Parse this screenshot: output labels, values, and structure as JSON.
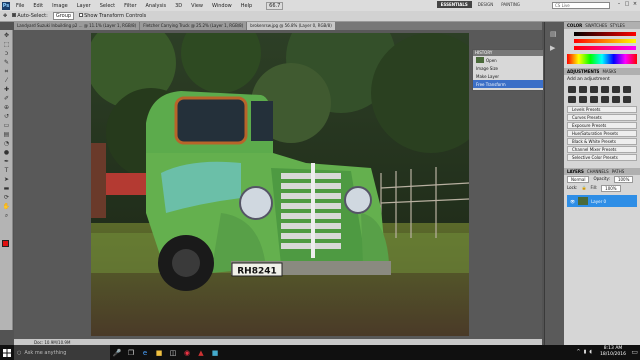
{
  "menu": {
    "logo": "Ps",
    "items": [
      "File",
      "Edit",
      "Image",
      "Layer",
      "Select",
      "Filter",
      "Analysis",
      "3D",
      "View",
      "Window",
      "Help"
    ],
    "zoom": "66.7"
  },
  "workspace": {
    "essentials": "ESSENTIALS",
    "design": "DESIGN",
    "painting": "PAINTING"
  },
  "cs_live": "CS Live",
  "options": {
    "auto_select": "Auto-Select:",
    "group": "Group",
    "show_transform": "Show Transform Controls"
  },
  "tabs": [
    "Landyard Suzuki Inbuilding p2 ... @ 11.1% (Layer 1, RGB/8)",
    "Fletcher Carrying Truck @ 25.2% (Layer 1, RGB/8)",
    "brokenrsw.jpg @ 56.8% (Layer 0, RGB/8)"
  ],
  "plate": "RH8241",
  "status": {
    "zoom": "Doc: 10.9M/10.9M"
  },
  "history": {
    "items": [
      "Open",
      "Image Size",
      "Make Layer",
      "Free Transform"
    ],
    "selected": 3
  },
  "right_panel": {
    "color_tabs": [
      "COLOR",
      "SWATCHES",
      "STYLES"
    ],
    "adj_tabs": [
      "ADJUSTMENTS",
      "MASKS"
    ],
    "adj_title": "Add an adjustment",
    "presets": [
      "Levels Presets",
      "Curves Presets",
      "Exposure Presets",
      "Hue/Saturation Presets",
      "Black & White Presets",
      "Channel Mixer Presets",
      "Selective Color Presets"
    ],
    "layer_tabs": [
      "LAYERS",
      "CHANNELS",
      "PATHS"
    ],
    "blend": "Normal",
    "opacity_label": "Opacity:",
    "opacity": "100%",
    "lock_label": "Lock:",
    "fill_label": "Fill:",
    "fill": "100%",
    "layer_name": "Layer 0"
  },
  "taskbar": {
    "search": "Ask me anything",
    "time": "8:13 AM",
    "date": "18/10/2016"
  },
  "colors": {
    "accent": "#3c6fc7",
    "truck": "#5cab4c",
    "bg": "#535353"
  }
}
